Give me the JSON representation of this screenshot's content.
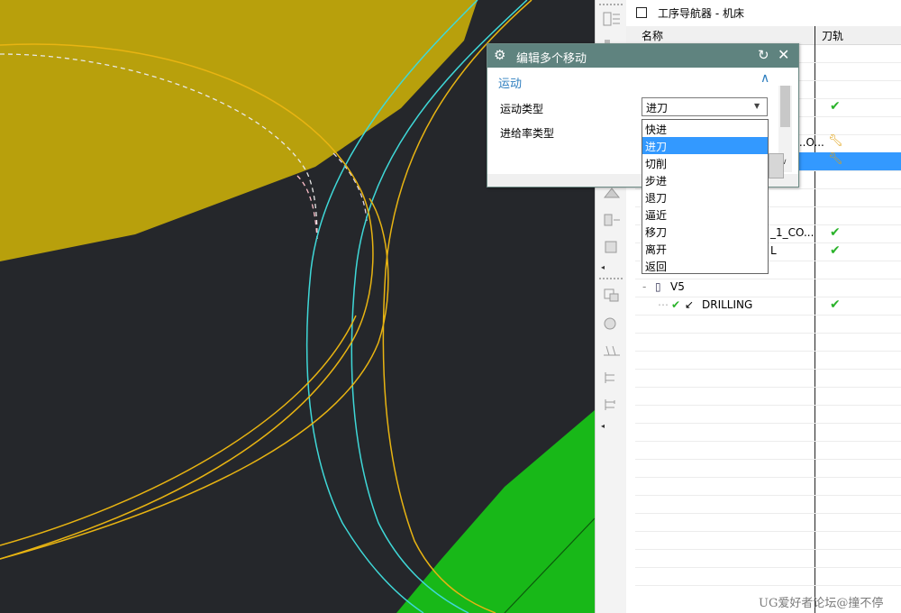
{
  "navigator": {
    "title": "工序导航器 - 机床",
    "col_name": "名称",
    "col_toolpath": "刀轨",
    "rows": [
      {
        "label": "...O...",
        "status": "wrench"
      },
      {
        "label": "",
        "status": "wrench"
      },
      {
        "label": "_1_CO...",
        "status": "check"
      },
      {
        "label": "L",
        "status": "check"
      },
      {
        "label": "V5",
        "status": "none"
      },
      {
        "label": "DRILLING",
        "status": "check"
      }
    ]
  },
  "dialog": {
    "title": "编辑多个移动",
    "group_label": "运动",
    "motion_type_label": "运动类型",
    "feed_type_label": "进给率类型",
    "motion_type_value": "进刀",
    "options": [
      "快进",
      "进刀",
      "切削",
      "步进",
      "退刀",
      "逼近",
      "移刀",
      "离开",
      "返回"
    ],
    "selected_option": "进刀"
  },
  "watermark": "UG爱好者论坛@撞不停",
  "colors": {
    "viewport_bg": "#25272b",
    "yellow_surface": "#b8a00c",
    "green_surface": "#18b818",
    "dialog_title_bg": "#5f837f",
    "selection": "#3399ff"
  }
}
